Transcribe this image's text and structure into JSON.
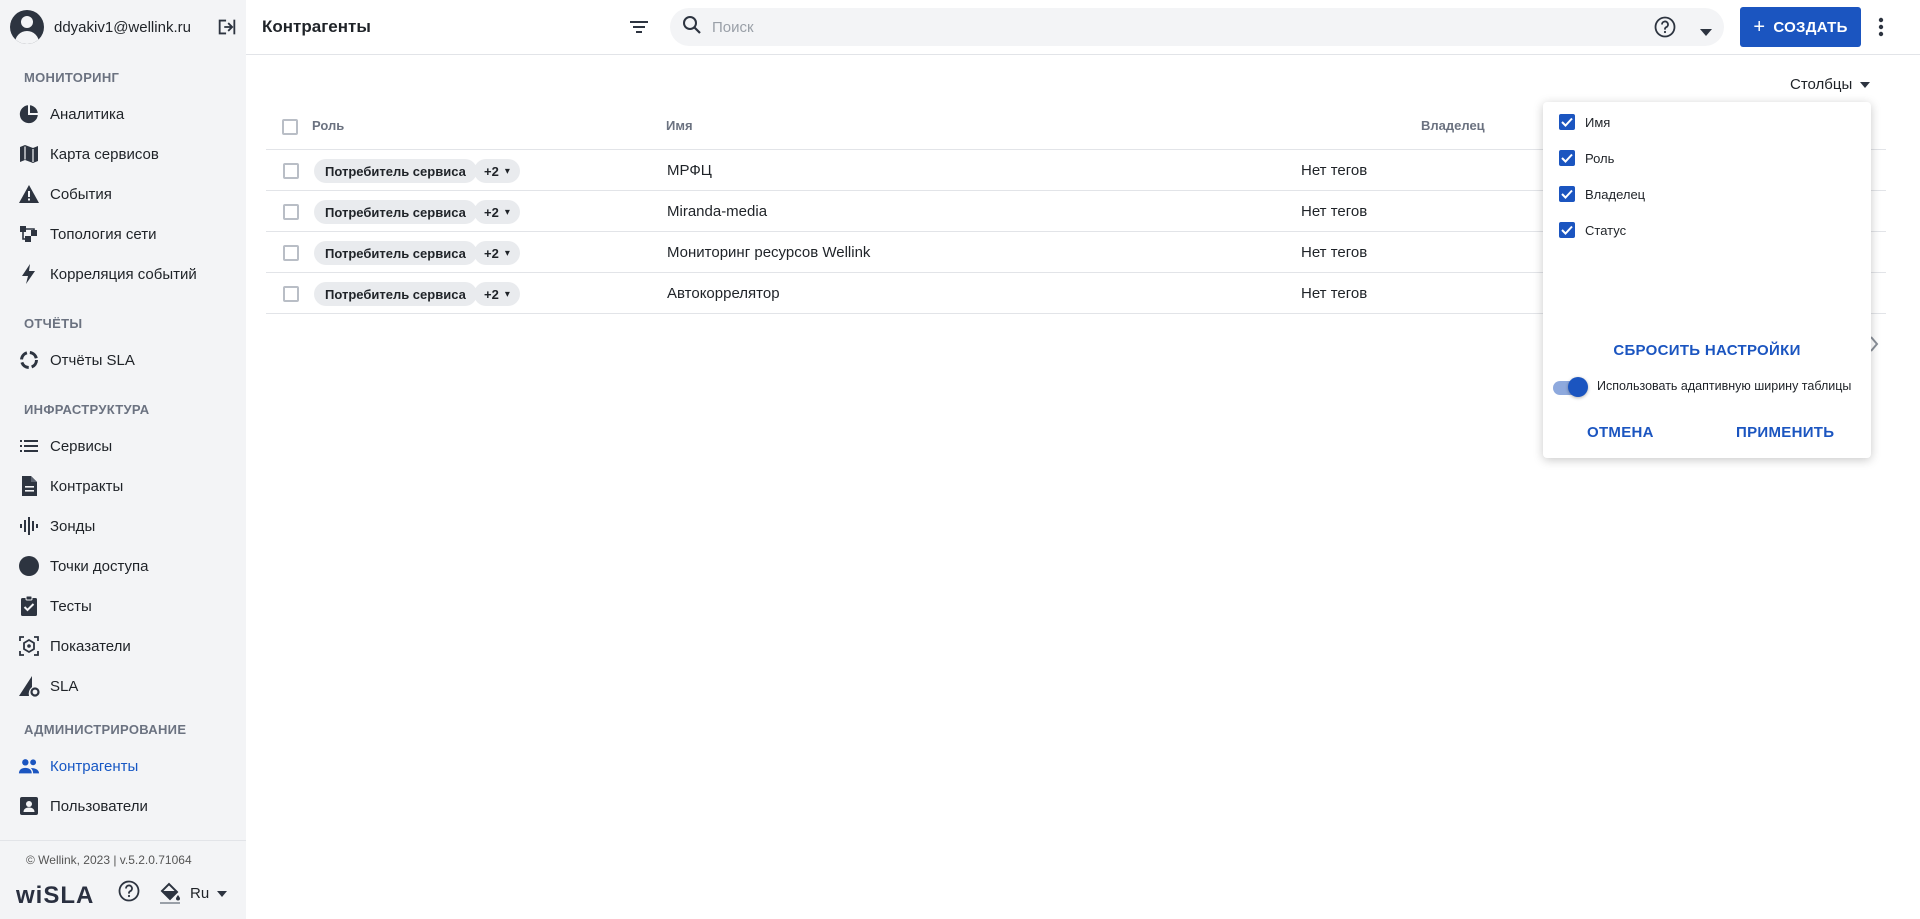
{
  "sidebar": {
    "user_email": "ddyakiv1@wellink.ru",
    "sections": {
      "monitoring": "МОНИТОРИНГ",
      "reports": "ОТЧЁТЫ",
      "infrastructure": "ИНФРАСТРУКТУРА",
      "administration": "АДМИНИСТРИРОВАНИЕ"
    },
    "items": {
      "analytics": "Аналитика",
      "service_map": "Карта сервисов",
      "events": "События",
      "topology": "Топология сети",
      "correlation": "Корреляция событий",
      "sla_reports": "Отчёты SLA",
      "services": "Сервисы",
      "contracts": "Контракты",
      "probes": "Зонды",
      "access_points": "Точки доступа",
      "tests": "Тесты",
      "indicators": "Показатели",
      "sla": "SLA",
      "counterparties": "Контрагенты",
      "users": "Пользователи"
    },
    "active_item": "counterparties",
    "copyright": "© Wellink, 2023 | v.5.2.0.71064",
    "logo": "wiSLA",
    "language": "Ru"
  },
  "header": {
    "title": "Контрагенты",
    "search_placeholder": "Поиск",
    "create_label": "СОЗДАТЬ"
  },
  "table": {
    "columns_button": "Столбцы",
    "headers": {
      "role": "Роль",
      "name": "Имя",
      "owner": "Владелец"
    },
    "rows": [
      {
        "role": "Потребитель сервиса",
        "more": "+2",
        "name": "МРФЦ",
        "tags": "Нет тегов"
      },
      {
        "role": "Потребитель сервиса",
        "more": "+2",
        "name": "Miranda-media",
        "tags": "Нет тегов"
      },
      {
        "role": "Потребитель сервиса",
        "more": "+2",
        "name": "Мониторинг ресурсов Wellink",
        "tags": "Нет тегов"
      },
      {
        "role": "Потребитель сервиса",
        "more": "+2",
        "name": "Автокоррелятор",
        "tags": "Нет тегов"
      }
    ]
  },
  "columns_popup": {
    "options": [
      {
        "label": "Имя",
        "checked": true
      },
      {
        "label": "Роль",
        "checked": true
      },
      {
        "label": "Владелец",
        "checked": true
      },
      {
        "label": "Статус",
        "checked": true
      }
    ],
    "reset_label": "СБРОСИТЬ НАСТРОЙКИ",
    "adaptive_width_label": "Использовать адаптивную ширину таблицы",
    "adaptive_width_on": true,
    "cancel_label": "ОТМЕНА",
    "apply_label": "ПРИМЕНИТЬ"
  },
  "colors": {
    "accent": "#1b55c0",
    "sidebar_bg": "#f3f4f6",
    "icon": "#2d3440"
  }
}
